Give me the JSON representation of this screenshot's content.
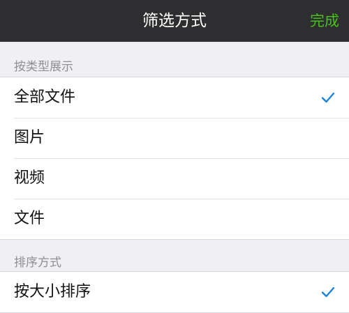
{
  "header": {
    "title": "筛选方式",
    "done_label": "完成"
  },
  "display_section": {
    "header": "按类型展示",
    "items": [
      {
        "label": "全部文件",
        "selected": true
      },
      {
        "label": "图片",
        "selected": false
      },
      {
        "label": "视频",
        "selected": false
      },
      {
        "label": "文件",
        "selected": false
      }
    ]
  },
  "sort_section": {
    "header": "排序方式",
    "items": [
      {
        "label": "按大小排序",
        "selected": true
      }
    ]
  },
  "colors": {
    "nav_background": "#2e2e30",
    "done_accent": "#46c11a",
    "check_accent": "#1a82d8",
    "page_background": "#efeff4"
  },
  "icons": {
    "selected": "checkmark-icon"
  }
}
